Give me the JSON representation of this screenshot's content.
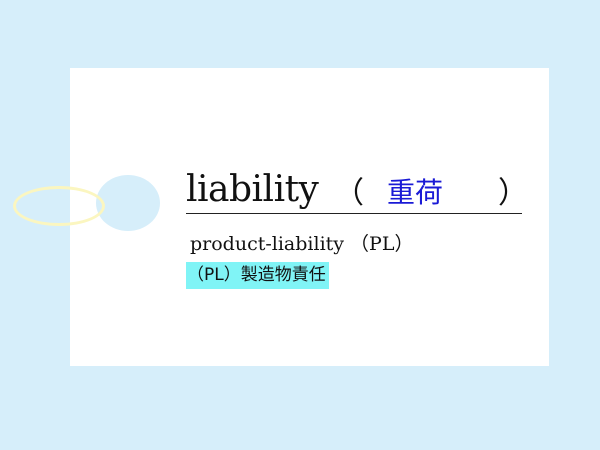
{
  "card": {
    "headword": "liability",
    "paren_open": "（",
    "answer": "重荷",
    "paren_close": "）",
    "example": "product-liability （PL）",
    "translation": "（PL）製造物責任"
  },
  "colors": {
    "background": "#d6eefa",
    "card": "#ffffff",
    "answer_text": "#1a1ad6",
    "highlight": "#80f4f6",
    "tag_string": "#fbf6c0"
  }
}
